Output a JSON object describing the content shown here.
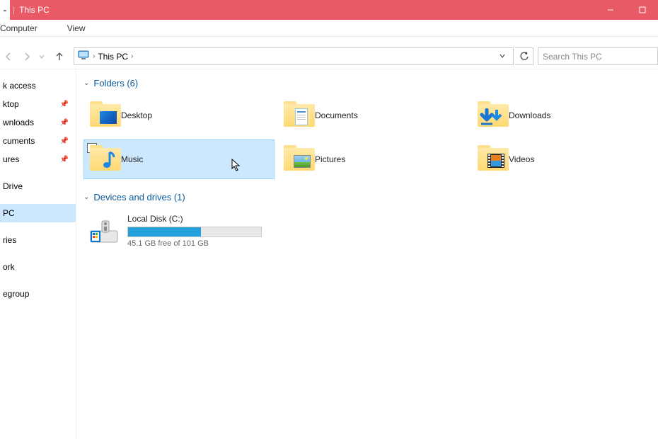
{
  "titlebar": {
    "title": "This PC"
  },
  "ribbon": {
    "tabs": [
      "Computer",
      "View"
    ]
  },
  "nav": {
    "current": "This PC",
    "search_placeholder": "Search This PC"
  },
  "sidebar": {
    "items": [
      {
        "label": "k access",
        "pinned": false
      },
      {
        "label": "ktop",
        "pinned": true
      },
      {
        "label": "wnloads",
        "pinned": true
      },
      {
        "label": "cuments",
        "pinned": true
      },
      {
        "label": "ures",
        "pinned": true
      }
    ],
    "items2": [
      {
        "label": "Drive"
      }
    ],
    "items3": [
      {
        "label": "PC",
        "selected": true
      }
    ],
    "items4": [
      {
        "label": "ries"
      }
    ],
    "items5": [
      {
        "label": "ork"
      }
    ],
    "items6": [
      {
        "label": "egroup"
      }
    ]
  },
  "main": {
    "folders_header": "Folders (6)",
    "folders": [
      {
        "label": "Desktop",
        "type": "desktop"
      },
      {
        "label": "Documents",
        "type": "documents"
      },
      {
        "label": "Downloads",
        "type": "downloads"
      },
      {
        "label": "Music",
        "type": "music",
        "selected": true
      },
      {
        "label": "Pictures",
        "type": "pictures"
      },
      {
        "label": "Videos",
        "type": "videos"
      }
    ],
    "drives_header": "Devices and drives (1)",
    "drives": [
      {
        "name": "Local Disk (C:)",
        "free_text": "45.1 GB free of 101 GB",
        "fill_percent": 55
      }
    ]
  }
}
